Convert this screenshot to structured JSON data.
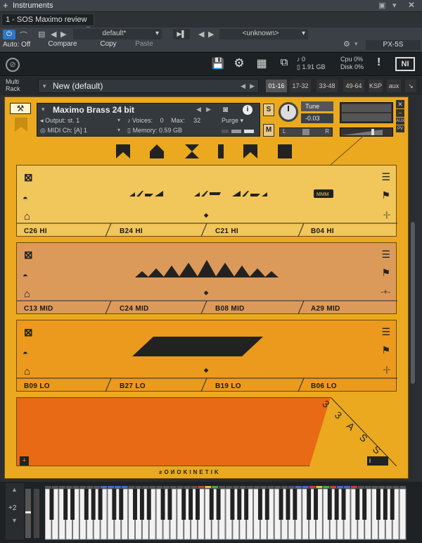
{
  "window": {
    "title": "Instruments",
    "doc_tab": "1 - SOS Maximo review"
  },
  "host": {
    "preset": "default*",
    "unknown": "<unknown>",
    "auto_off": "Auto: Off",
    "compare": "Compare",
    "copy": "Copy",
    "paste": "Paste",
    "device": "PX-5S"
  },
  "kontakt": {
    "voices_top": "0",
    "mem_top": "1.91 GB",
    "cpu_label": "Cpu",
    "cpu_val": "0%",
    "disk_label": "Disk",
    "disk_val": "0%",
    "ni_logo": "NI"
  },
  "rack": {
    "label1": "Multi",
    "label2": "Rack",
    "preset": "New (default)",
    "pages": [
      "01-16",
      "17-32",
      "33-48",
      "49-64"
    ],
    "ksp": "KSP",
    "aux": "aux"
  },
  "instrument": {
    "name": "Maximo Brass 24 bit",
    "output_label": "Output:",
    "output_val": "st. 1",
    "voices_label": "Voices:",
    "voices_val": "0",
    "max_label": "Max:",
    "max_val": "32",
    "purge": "Purge",
    "midi_label": "MIDI Ch:",
    "midi_val": "[A] 1",
    "memory_label": "Memory:",
    "memory_val": "0.59 GB",
    "tune_label": "Tune",
    "tune_val": "-0.03",
    "s": "S",
    "m": "M",
    "aux_label": "AUX",
    "pv_label": "PV",
    "l": "L",
    "r": "R"
  },
  "panels": [
    {
      "caps": [
        "C26 HI",
        "B24 HI",
        "C21 HI",
        "B04 HI"
      ]
    },
    {
      "caps": [
        "C13 MID",
        "C24 MID",
        "B08 MID",
        "A29 MID"
      ]
    },
    {
      "caps": [
        "B09 LO",
        "B27 LO",
        "B19 LO",
        "B06 LO"
      ]
    }
  ],
  "bottom": {
    "sidelabel": "3 3 A S S",
    "logo": "ƨOИOKINETIK",
    "plus": "+",
    "info": "i"
  },
  "keyboard": {
    "octave": "+2"
  }
}
